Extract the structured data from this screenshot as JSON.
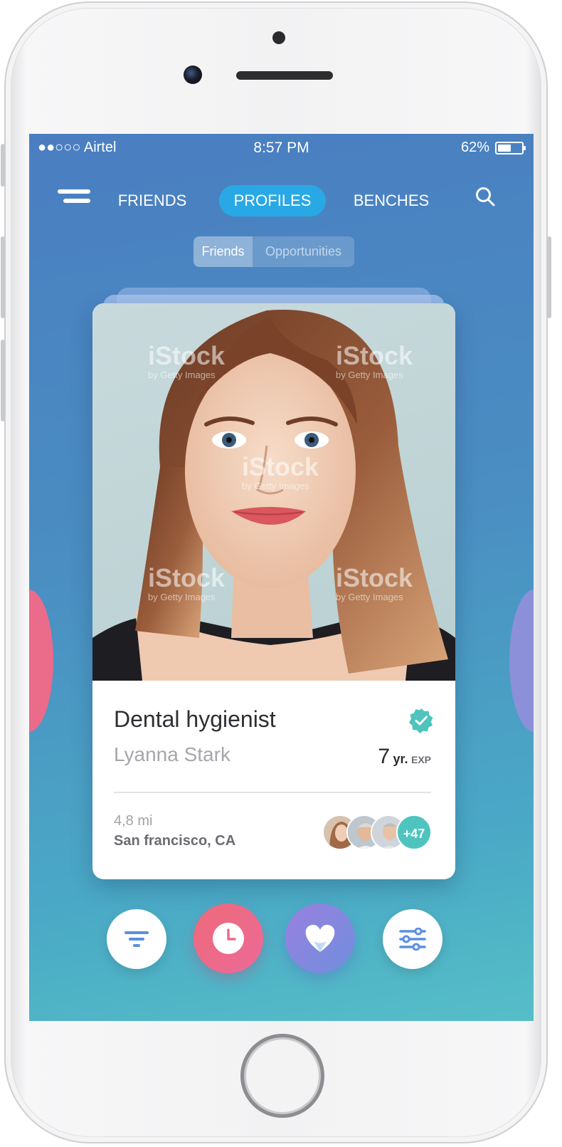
{
  "status_bar": {
    "carrier": "●●○○○ Airtel",
    "time": "8:57 PM",
    "battery": "62%",
    "battery_level": 0.62
  },
  "nav": {
    "menu_icon": "hamburger-icon",
    "tabs": [
      {
        "label": "FRIENDS",
        "active": false
      },
      {
        "label": "PROFILES",
        "active": true
      },
      {
        "label": "BENCHES",
        "active": false
      }
    ],
    "search_icon": "search-icon",
    "active_color": "#29a8e6"
  },
  "segment": {
    "options": [
      {
        "label": "Friends",
        "active": true
      },
      {
        "label": "Opportunities",
        "active": false
      }
    ]
  },
  "card": {
    "photo_watermark": "iStock",
    "photo_watermark_sub": "by Getty Images",
    "title": "Dental hygienist",
    "name": "Lyanna Stark",
    "verified_icon": "verified-badge-icon",
    "verified_color": "#4fc4bf",
    "experience_value": "7",
    "experience_unit_yr": "yr.",
    "experience_unit_exp": "EXP",
    "distance": "4,8 mi",
    "location": "San francisco, CA",
    "connections_more": "+47"
  },
  "actions": [
    {
      "icon": "filter-icon",
      "style": "white",
      "color": "#5b8fe0"
    },
    {
      "icon": "clock-icon",
      "style": "pink",
      "color": "#ee6a8d"
    },
    {
      "icon": "heart-icon",
      "style": "violet",
      "color": "#8f7fe0"
    },
    {
      "icon": "sliders-icon",
      "style": "white",
      "color": "#5b8fe0"
    }
  ]
}
